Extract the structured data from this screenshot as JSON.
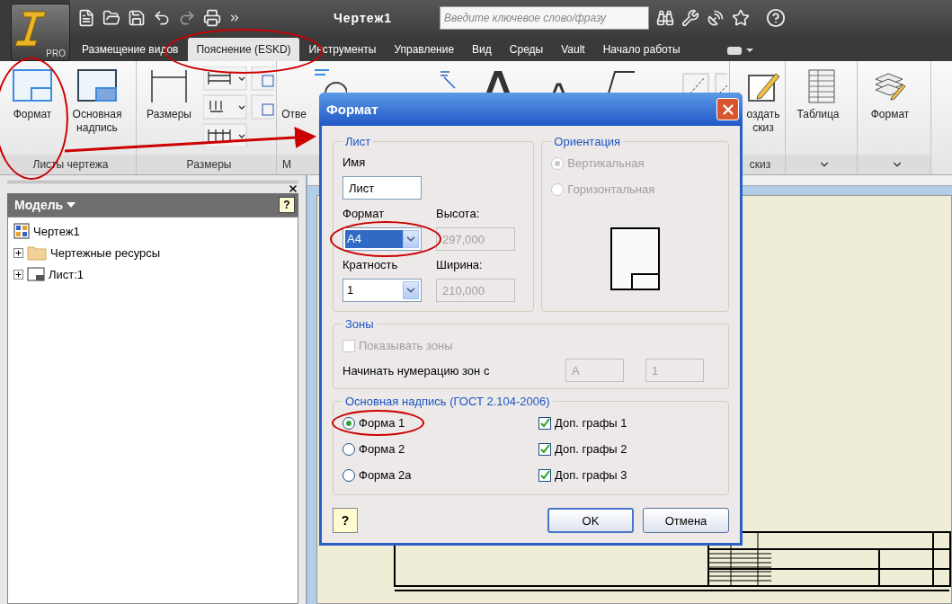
{
  "app_menu": {
    "badge": "PRO"
  },
  "window": {
    "title": "Чертеж1"
  },
  "search": {
    "placeholder": "Введите ключевое слово/фразу"
  },
  "tabs": [
    {
      "label": "Размещение видов",
      "selected": false
    },
    {
      "label": "Пояснение (ESKD)",
      "selected": true
    },
    {
      "label": "Инструменты",
      "selected": false
    },
    {
      "label": "Управление",
      "selected": false
    },
    {
      "label": "Вид",
      "selected": false
    },
    {
      "label": "Среды",
      "selected": false
    },
    {
      "label": "Vault",
      "selected": false
    },
    {
      "label": "Начало работы",
      "selected": false
    }
  ],
  "ribbon": {
    "groups": [
      {
        "kind": "sheets",
        "label": "Листы чертежа",
        "buttons": [
          "Формат",
          "Основная надпись"
        ]
      },
      {
        "kind": "dimensions",
        "label": "Размеры",
        "buttons": [
          "Размеры"
        ]
      },
      {
        "kind": "covered",
        "label": "М",
        "buttons": [
          "Отве"
        ]
      },
      {
        "kind": "sketch",
        "label": "скиз",
        "buttons": [
          "оздать скиз"
        ]
      },
      {
        "kind": "table",
        "buttons": [
          "Таблица"
        ]
      },
      {
        "kind": "format",
        "buttons": [
          "Формат"
        ]
      }
    ]
  },
  "model_browser": {
    "title": "Модель",
    "help_icon": "?",
    "tree": [
      {
        "label": "Чертеж1",
        "kind": "drawing",
        "children": [
          {
            "label": "Чертежные ресурсы",
            "kind": "folder",
            "expanded": false
          },
          {
            "label": "Лист:1",
            "kind": "sheet",
            "expanded": false
          }
        ]
      }
    ]
  },
  "dialog": {
    "title": "Формат",
    "help_icon": "?",
    "sheet": {
      "legend": "Лист",
      "name_label": "Имя",
      "name_value": "Лист",
      "format_label": "Формат",
      "format_value": "А4",
      "height_label": "Высота:",
      "height_value": "297,000",
      "multiplicity_label": "Кратность",
      "multiplicity_value": "1",
      "width_label": "Ширина:",
      "width_value": "210,000"
    },
    "orientation": {
      "legend": "Ориентация",
      "disabled": true,
      "options": [
        {
          "label": "Вертикальная",
          "selected": true
        },
        {
          "label": "Горизонтальная",
          "selected": false
        }
      ]
    },
    "zones": {
      "legend": "Зоны",
      "show_zones": {
        "label": "Показывать зоны",
        "checked": false,
        "disabled": true
      },
      "numbering_label": "Начинать нумерацию зон с",
      "start_letter": "А",
      "start_number": "1"
    },
    "title_block": {
      "legend": "Основная надпись (ГОСТ 2.104-2006)",
      "forms": [
        {
          "label": "Форма 1",
          "selected": true
        },
        {
          "label": "Форма 2",
          "selected": false
        },
        {
          "label": "Форма 2а",
          "selected": false
        }
      ],
      "extras": [
        {
          "label": "Доп. графы 1",
          "checked": true
        },
        {
          "label": "Доп. графы 2",
          "checked": true
        },
        {
          "label": "Доп. графы 3",
          "checked": true
        }
      ]
    },
    "buttons": [
      {
        "label": "OK",
        "kind": "default"
      },
      {
        "label": "Отмена",
        "kind": "normal"
      }
    ]
  }
}
